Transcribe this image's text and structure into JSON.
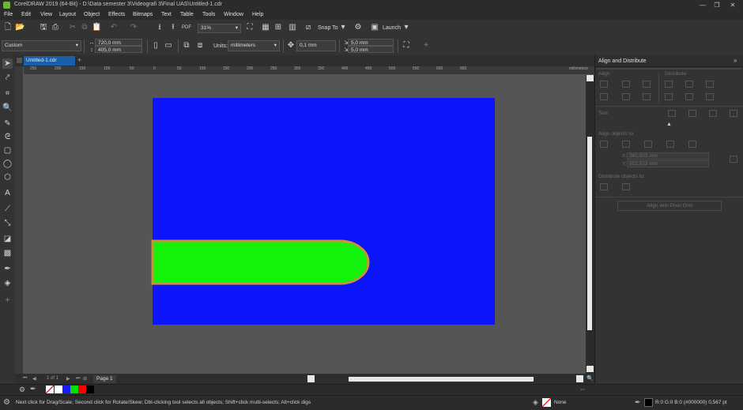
{
  "window": {
    "title": "CorelDRAW 2019 (64-Bit) - D:\\Data semester 3\\Videografi 3\\Final UAS\\Untitled-1.cdr",
    "minimize": "—",
    "restore": "❐",
    "close": "✕"
  },
  "menu": [
    "File",
    "Edit",
    "View",
    "Layout",
    "Object",
    "Effects",
    "Bitmaps",
    "Text",
    "Table",
    "Tools",
    "Window",
    "Help"
  ],
  "toolbar": {
    "zoom": "31%",
    "snap_to": "Snap To",
    "launch": "Launch"
  },
  "property_bar": {
    "page_preset": "Custom",
    "width": "720,0 mm",
    "height": "405,0 mm",
    "units_label": "Units:",
    "units_value": "millimeters",
    "nudge": "0,1 mm",
    "dup_x": "5,0 mm",
    "dup_y": "5,0 mm",
    "add": "+"
  },
  "document_tab": {
    "label": "Untitled-1.cdr",
    "add": "+"
  },
  "ruler": {
    "top_labels": [
      "250",
      "200",
      "150",
      "100",
      "50",
      "0",
      "50",
      "100",
      "150",
      "200",
      "250",
      "300",
      "350",
      "400",
      "450",
      "500",
      "550",
      "600",
      "650"
    ],
    "unit": "millimeters"
  },
  "canvas": {
    "background_color": "#555555",
    "page_color": "#0b14fb",
    "shape_color": "#13f20a",
    "shape_outline": "#c8913a"
  },
  "page_nav": {
    "page_label": "Page 1",
    "of": "1 of 1"
  },
  "palette": {
    "colors": [
      "#ffffff",
      "#1a1aff",
      "#00e000",
      "#ff0000",
      "#000000"
    ]
  },
  "status": {
    "hint": "Next click for Drag/Scale; Second click for Rotate/Skew; Dbl-clicking tool selects all objects; Shift+click multi-selects; Alt+click digs",
    "fill_label": "None",
    "outline_label": "R:0 G:0 B:0 (#000000)  0,567 pt"
  },
  "docker": {
    "title": "Align and Distribute",
    "align": "Align",
    "distribute": "Distribute",
    "text": "Text",
    "align_objects_to": "Align objects to:",
    "x_value": "360,003 mm",
    "y_value": "202,523 mm",
    "distribute_objects_to": "Distribute objects to:",
    "align_pixel_grid": "Align with Pixel Grid"
  }
}
